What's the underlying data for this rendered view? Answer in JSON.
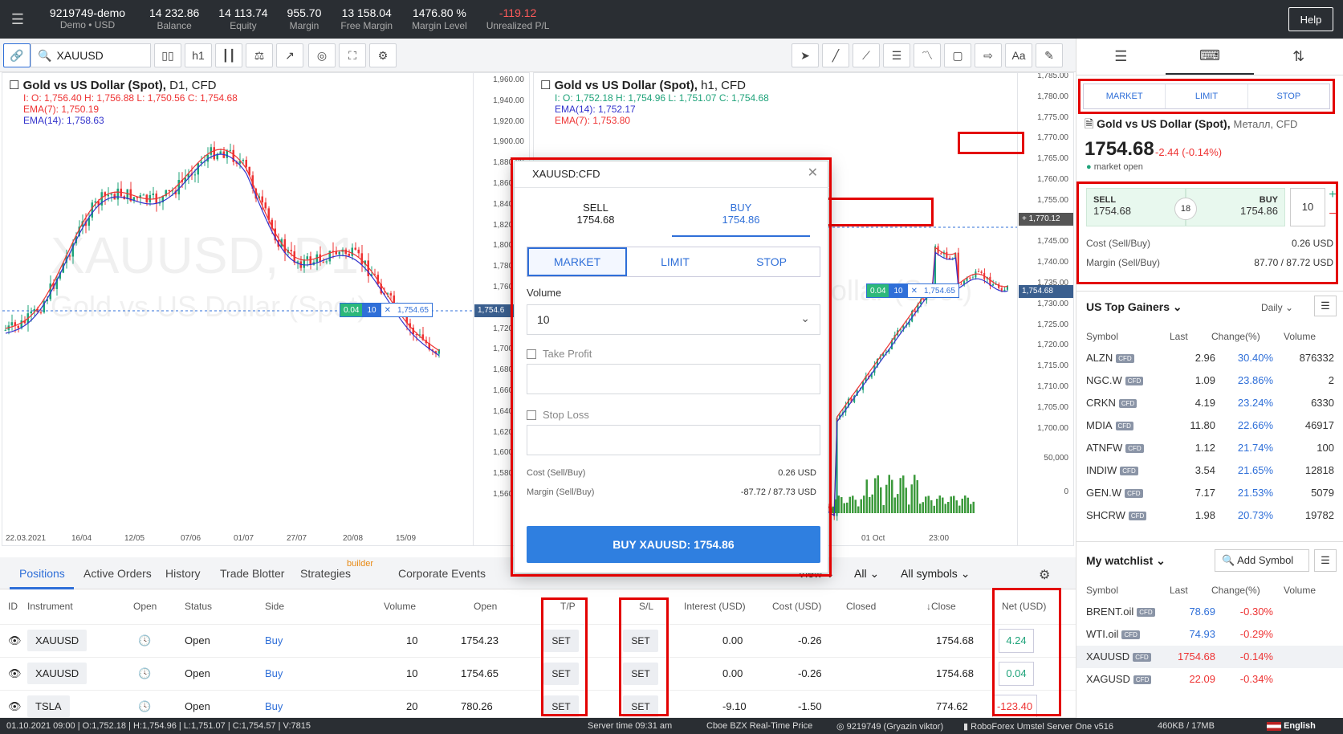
{
  "topbar": {
    "account": "9219749-demo",
    "account_sub": "Demo • USD",
    "stats": [
      {
        "value": "14 232.86",
        "label": "Balance"
      },
      {
        "value": "14 113.74",
        "label": "Equity"
      },
      {
        "value": "955.70",
        "label": "Margin"
      },
      {
        "value": "13 158.04",
        "label": "Free Margin"
      },
      {
        "value": "1476.80 %",
        "label": "Margin Level"
      },
      {
        "value": "-119.12",
        "label": "Unrealized P/L"
      }
    ],
    "help": "Help"
  },
  "toolbar": {
    "symbol": "XAUUSD",
    "timeframe": "h1"
  },
  "chart_left": {
    "title": "Gold vs US Dollar (Spot),",
    "title_meta": "D1,  CFD",
    "ohlc": "I: O: 1,756.40  H: 1,756.88  L: 1,750.56  C: 1,754.68",
    "ema1": "EMA(7): 1,750.19",
    "ema2": "EMA(14): 1,758.63",
    "watermark1": "XAUUSD, D1",
    "watermark2": "Gold vs US Dollar (Spot)",
    "yticks": [
      "1,960.00",
      "1,940.00",
      "1,920.00",
      "1,900.00",
      "1,880.00",
      "1,860.00",
      "1,840.00",
      "1,820.00",
      "1,800.00",
      "1,780.00",
      "1,760.00",
      "1,740.00",
      "1,720.00",
      "1,700.00",
      "1,680.00",
      "1,660.00",
      "1,640.00",
      "1,620.00",
      "1,600.00",
      "1,580.00",
      "1,560.00"
    ],
    "xticks": [
      "22.03.2021",
      "16/04",
      "12/05",
      "07/06",
      "01/07",
      "27/07",
      "20/08",
      "15/09"
    ],
    "order_line": {
      "pl": "0.04",
      "vol": "10",
      "price": "1,754.65"
    },
    "price_tag": "1,754.6"
  },
  "chart_right": {
    "title": "Gold vs US Dollar (Spot),",
    "title_meta": "h1,  CFD",
    "ohlc": "I: O: 1,752.18  H: 1,754.96  L: 1,751.07  C: 1,754.68",
    "ema1": "EMA(14): 1,752.17",
    "ema2": "EMA(7): 1,753.80",
    "watermark2": "ollar (Spot)",
    "yticks": [
      "1,785.00",
      "1,780.00",
      "1,775.00",
      "1,770.00",
      "1,765.00",
      "1,760.00",
      "1,755.00",
      "1,750.00",
      "1,745.00",
      "1,740.00",
      "1,735.00",
      "1,730.00",
      "1,725.00",
      "1,720.00",
      "1,715.00",
      "1,710.00",
      "1,705.00",
      "1,700.00"
    ],
    "vol_ticks": [
      "50,000",
      "0"
    ],
    "xticks": [
      "30 Sep",
      "01 Oct",
      "23:00"
    ],
    "plus_price": "1,770.12",
    "price_tag": "1,754.68",
    "order_line": {
      "pl": "0.04",
      "vol": "10",
      "price": "1,754.65"
    }
  },
  "modal": {
    "title": "XAUUSD:CFD",
    "sell_label": "SELL",
    "sell_price": "1754.68",
    "buy_label": "BUY",
    "buy_price": "1754.86",
    "types": [
      "MARKET",
      "LIMIT",
      "STOP"
    ],
    "volume_label": "Volume",
    "volume": "10",
    "take_profit": "Take Profit",
    "stop_loss": "Stop Loss",
    "cost_label": "Cost (Sell/Buy)",
    "cost_value": "0.26 USD",
    "margin_label": "Margin (Sell/Buy)",
    "margin_value": "-87.72 / 87.73 USD",
    "buy_button": "BUY XAUUSD: 1754.86"
  },
  "rpanel": {
    "order_types": [
      "MARKET",
      "LIMIT",
      "STOP"
    ],
    "instrument": "Gold vs US Dollar (Spot),",
    "instrument_meta": "Металл, CFD",
    "price": "1754.68",
    "change": "-2.44 (-0.14%)",
    "market_status": "market open",
    "sell_label": "SELL",
    "sell_price": "1754.68",
    "spread": "18",
    "buy_label": "BUY",
    "buy_price": "1754.86",
    "qty": "10",
    "cost_label": "Cost (Sell/Buy)",
    "cost_value": "0.26 USD",
    "margin_label": "Margin (Sell/Buy)",
    "margin_value": "87.70 / 87.72 USD",
    "gainers_title": "US Top Gainers",
    "gainers_period": "Daily",
    "columns": [
      "Symbol",
      "Last",
      "Change(%)",
      "Volume"
    ],
    "gainers": [
      {
        "sym": "ALZN",
        "last": "2.96",
        "chg": "30.40%",
        "vol": "876332"
      },
      {
        "sym": "NGC.W",
        "last": "1.09",
        "chg": "23.86%",
        "vol": "2"
      },
      {
        "sym": "CRKN",
        "last": "4.19",
        "chg": "23.24%",
        "vol": "6330"
      },
      {
        "sym": "MDIA",
        "last": "11.80",
        "chg": "22.66%",
        "vol": "46917"
      },
      {
        "sym": "ATNFW",
        "last": "1.12",
        "chg": "21.74%",
        "vol": "100"
      },
      {
        "sym": "INDIW",
        "last": "3.54",
        "chg": "21.65%",
        "vol": "12818"
      },
      {
        "sym": "GEN.W",
        "last": "7.17",
        "chg": "21.53%",
        "vol": "5079"
      },
      {
        "sym": "SHCRW",
        "last": "1.98",
        "chg": "20.73%",
        "vol": "19782"
      }
    ],
    "watchlist_title": "My watchlist",
    "add_symbol": "Add Symbol",
    "watchlist": [
      {
        "sym": "BRENT.oil",
        "last": "78.69",
        "chg": "-0.30%"
      },
      {
        "sym": "WTI.oil",
        "last": "74.93",
        "chg": "-0.29%"
      },
      {
        "sym": "XAUUSD",
        "last": "1754.68",
        "chg": "-0.14%"
      },
      {
        "sym": "XAGUSD",
        "last": "22.09",
        "chg": "-0.34%"
      }
    ],
    "cfd": "CFD"
  },
  "bottom": {
    "tabs": [
      "Positions",
      "Active Orders",
      "History",
      "Trade Blotter",
      "Strategies",
      "Corporate Events"
    ],
    "builder": "builder",
    "filters": [
      "View",
      "All",
      "All symbols"
    ],
    "columns": [
      "ID",
      "Instrument",
      "Open",
      "Status",
      "Side",
      "Volume",
      "Open",
      "T/P",
      "S/L",
      "Interest (USD)",
      "Cost (USD)",
      "Closed",
      "↓Close",
      "Net (USD)"
    ],
    "set": "SET",
    "rows": [
      {
        "instr": "XAUUSD",
        "status": "Open",
        "side": "Buy",
        "vol": "10",
        "open": "1754.23",
        "interest": "0.00",
        "cost": "-0.26",
        "close": "1754.68",
        "net": "4.24"
      },
      {
        "instr": "XAUUSD",
        "status": "Open",
        "side": "Buy",
        "vol": "10",
        "open": "1754.65",
        "interest": "0.00",
        "cost": "-0.26",
        "close": "1754.68",
        "net": "0.04"
      },
      {
        "instr": "TSLA",
        "status": "Open",
        "side": "Buy",
        "vol": "20",
        "open": "780.26",
        "interest": "-9.10",
        "cost": "-1.50",
        "close": "774.62",
        "net": "-123.40"
      }
    ]
  },
  "status": {
    "left": "01.10.2021 09:00 | O:1,752.18 | H:1,754.96 | L:1,751.07 | C:1,754.57 | V:7815",
    "server_time": "Server time 09:31 am",
    "feed": "Cboe BZX Real-Time Price",
    "user": "9219749 (Gryazin viktor)",
    "server": "RoboForex Umstel Server One v516",
    "traffic": "460KB / 17MB",
    "lang": "English"
  }
}
